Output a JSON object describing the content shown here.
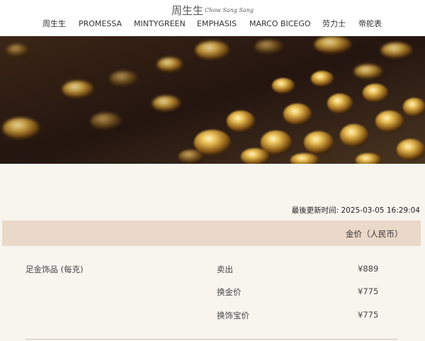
{
  "brand": {
    "name_cn": "周生生",
    "name_en": "Chow Sang Sang"
  },
  "nav": {
    "items": [
      "周生生",
      "PROMESSA",
      "MINTYGREEN",
      "EMPHASIS",
      "MARCO BICEGO",
      "劳力士",
      "帝舵表"
    ]
  },
  "price_table": {
    "last_updated_label": "最後更新时间:",
    "last_updated_value": "2025-03-05 16:29:04",
    "column_header": "金价（人民币）",
    "category": "足金饰品 (每克)",
    "rows": [
      {
        "label": "卖出",
        "value": "¥889"
      },
      {
        "label": "换金价",
        "value": "¥775"
      },
      {
        "label": "换饰宝价",
        "value": "¥775"
      }
    ]
  }
}
